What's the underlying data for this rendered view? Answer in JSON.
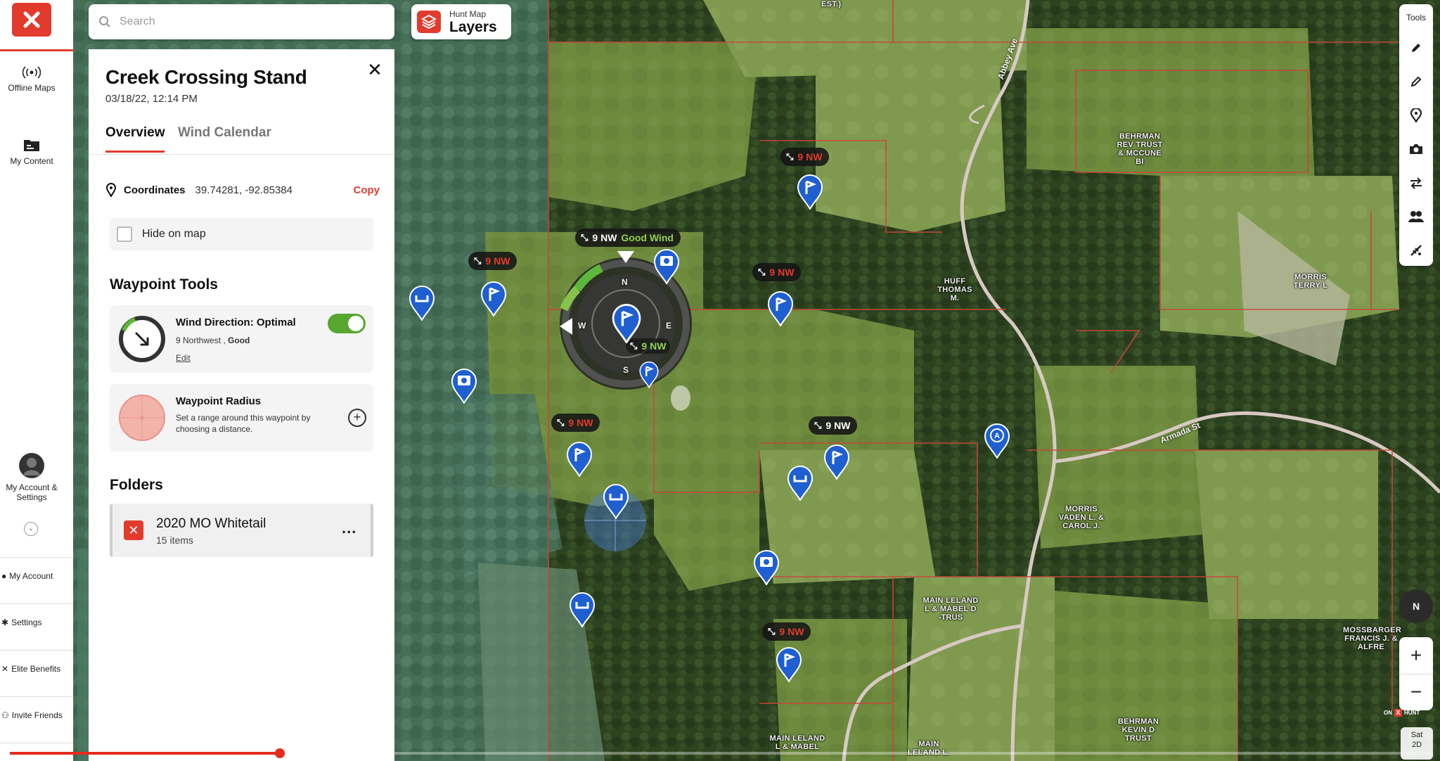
{
  "rail": {
    "offline_maps": "Offline Maps",
    "my_content": "My Content",
    "account_settings_line1": "My Account &",
    "account_settings_line2": "Settings",
    "menu": [
      "My Account",
      "Settings",
      "Elite Benefits",
      "Invite Friends"
    ]
  },
  "search": {
    "placeholder": "Search"
  },
  "layers": {
    "small": "Hunt Map",
    "big": "Layers"
  },
  "panel": {
    "title": "Creek Crossing Stand",
    "date": "03/18/22, 12:14 PM",
    "tabs": [
      "Overview",
      "Wind Calendar"
    ],
    "coordinates_label": "Coordinates",
    "coordinates_value": "39.74281, -92.85384",
    "copy_label": "Copy",
    "hide_label": "Hide on map",
    "tools_heading": "Waypoint Tools",
    "wind": {
      "title": "Wind Direction: Optimal",
      "sub_plain": "9 Northwest , ",
      "sub_bold": "Good",
      "edit": "Edit",
      "enabled": true
    },
    "radius": {
      "title": "Waypoint Radius",
      "sub_line1": "Set a range around this waypoint by",
      "sub_line2": "choosing a distance."
    },
    "folders_heading": "Folders",
    "folder": {
      "name": "2020 MO Whitetail",
      "count": "15 items",
      "more": "..."
    }
  },
  "map": {
    "wind_tags": [
      {
        "text": "9 NW",
        "good": ""
      },
      {
        "text": "9 NW",
        "good": "Good Wind"
      },
      {
        "text": "9 NW",
        "good": ""
      },
      {
        "text": "9 NW",
        "good": ""
      },
      {
        "text": "9 NW",
        "good": ""
      },
      {
        "text": "9 NW",
        "good": ""
      },
      {
        "text": "9 NW",
        "good": ""
      }
    ],
    "compass_letters": {
      "n": "N",
      "e": "E",
      "s": "S",
      "w": "W",
      "under": "9 NW"
    },
    "parcels": [
      "EST.)",
      "BEHRMAN REV TRUST & MCCUNE BI",
      "HUFF THOMAS M.",
      "MORRIS TERRY L",
      "MORRIS VADEN L. & CAROL J.",
      "MAIN LELAND L & MABEL D -TRUS",
      "MOSSBARGER FRANCIS J. & ALFRE",
      "BEHRMAN KEVIN D TRUST",
      "MAIN LELAND L & MABEL",
      "MAIN LELAND L."
    ],
    "roads": [
      "Abbey Ave",
      "Armada St"
    ]
  },
  "tools": {
    "label": "Tools"
  },
  "compass_btn": "N",
  "zoom": {
    "in": "+",
    "out": "−"
  },
  "onx": {
    "on": "ON",
    "x": "X",
    "hunt": "HUNT"
  },
  "basemap": {
    "line1": "Sat",
    "line2": "2D"
  },
  "progress": {
    "fraction": 0.19
  },
  "colors": {
    "accent": "#e23b2e",
    "toggle_on": "#56a62f",
    "pin_blue": "#1f5fd0"
  }
}
